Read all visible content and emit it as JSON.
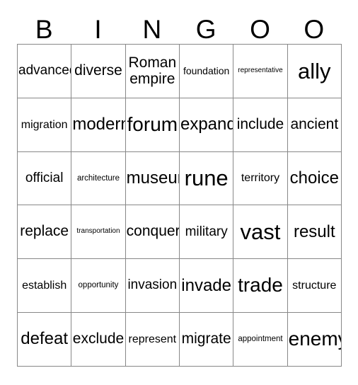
{
  "card": {
    "header_letters": [
      "B",
      "I",
      "N",
      "G",
      "O",
      "O"
    ],
    "grid": [
      [
        "advanced",
        "diverse",
        "Roman empire",
        "foundation",
        "representative",
        "ally"
      ],
      [
        "migration",
        "modern",
        "forum",
        "expand",
        "include",
        "ancient"
      ],
      [
        "official",
        "architecture",
        "museum",
        "rune",
        "territory",
        "choice"
      ],
      [
        "replace",
        "transportation",
        "conquer",
        "military",
        "vast",
        "result"
      ],
      [
        "establish",
        "opportunity",
        "invasion",
        "invade",
        "trade",
        "structure"
      ],
      [
        "defeat",
        "exclude",
        "represent",
        "migrate",
        "appointment",
        "enemy"
      ]
    ],
    "colors": {
      "background": "#ffffff",
      "text": "#000000",
      "border": "#888888"
    }
  }
}
